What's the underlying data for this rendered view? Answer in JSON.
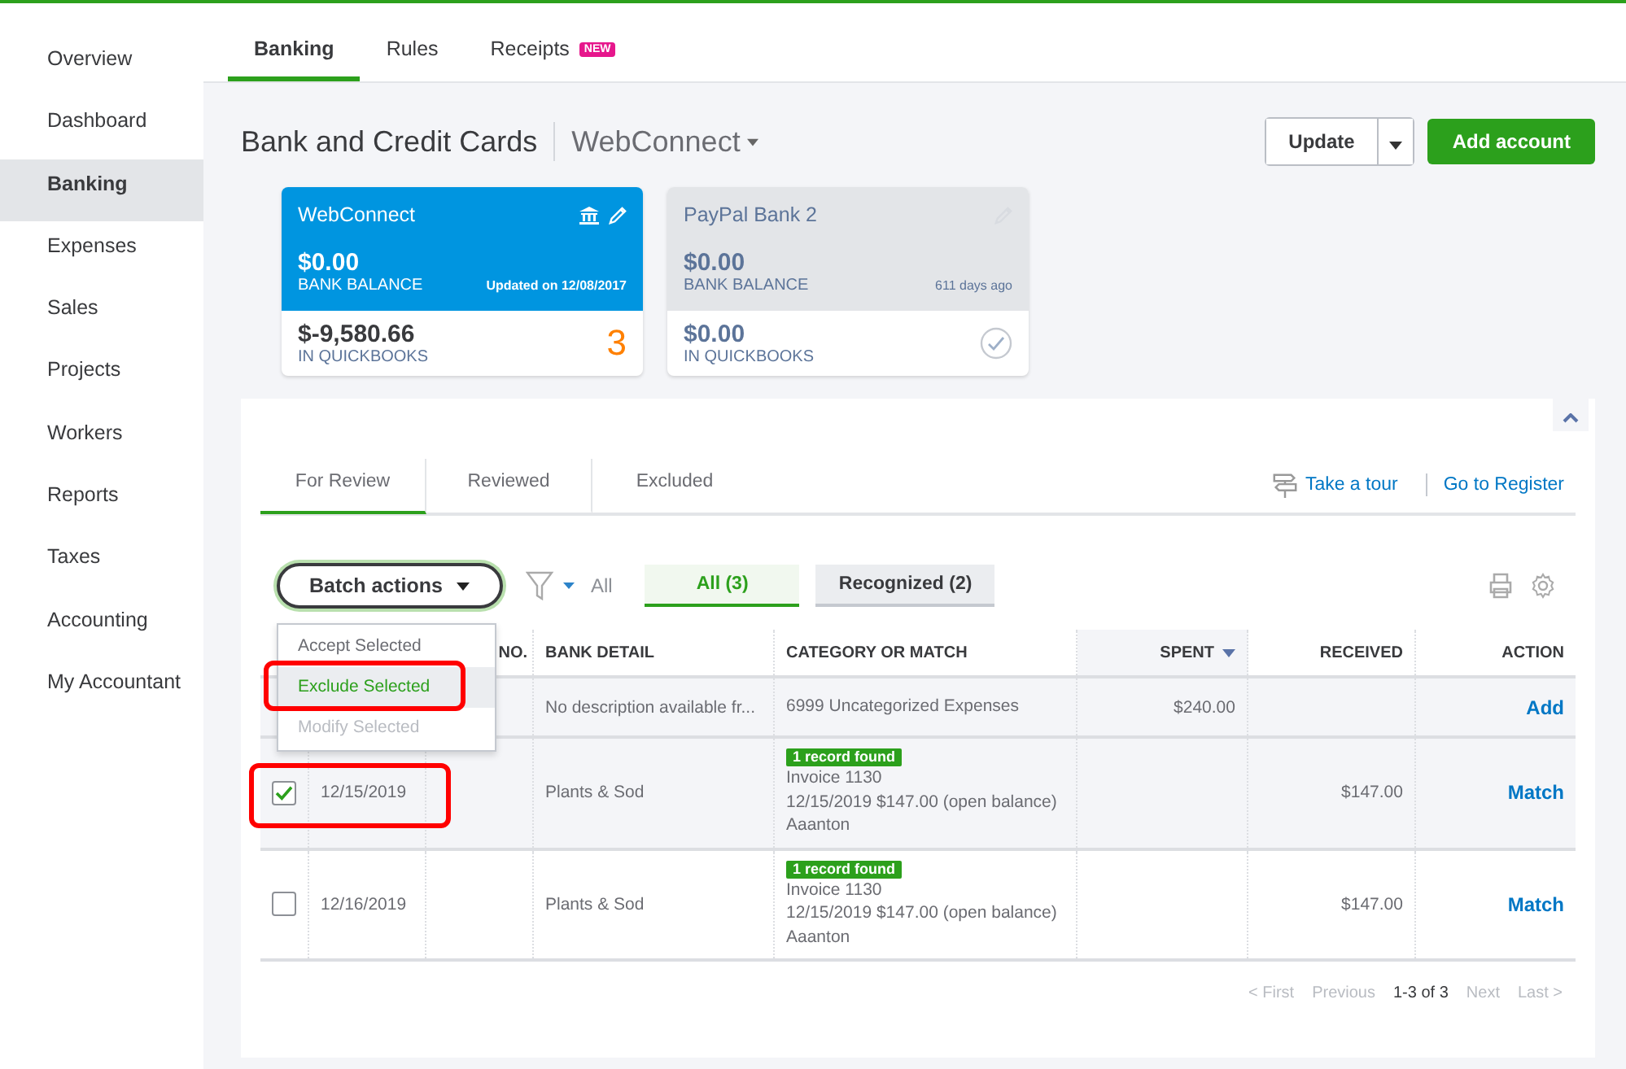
{
  "sidebar": {
    "items": [
      {
        "label": "Overview",
        "selected": false
      },
      {
        "label": "Dashboard",
        "selected": false
      },
      {
        "label": "Banking",
        "selected": true
      },
      {
        "label": "Expenses",
        "selected": false
      },
      {
        "label": "Sales",
        "selected": false
      },
      {
        "label": "Projects",
        "selected": false
      },
      {
        "label": "Workers",
        "selected": false
      },
      {
        "label": "Reports",
        "selected": false
      },
      {
        "label": "Taxes",
        "selected": false
      },
      {
        "label": "Accounting",
        "selected": false
      },
      {
        "label": "My Accountant",
        "selected": false
      }
    ]
  },
  "top_tabs": [
    {
      "label": "Banking",
      "selected": true
    },
    {
      "label": "Rules",
      "selected": false
    },
    {
      "label": "Receipts",
      "selected": false,
      "badge": "NEW"
    }
  ],
  "header": {
    "title": "Bank and Credit Cards",
    "account": "WebConnect",
    "buttons": [
      {
        "label": "Update",
        "kind": "split"
      },
      {
        "label": "Add account",
        "kind": "primary"
      }
    ]
  },
  "cards": [
    {
      "name": "WebConnect",
      "selected": true,
      "bank_balance": "$0.00",
      "bank_label": "BANK BALANCE",
      "updated": "Updated on 12/08/2017",
      "qb_balance": "$-9,580.66",
      "qb_label": "IN QUICKBOOKS",
      "count": "3"
    },
    {
      "name": "PayPal Bank 2",
      "selected": false,
      "bank_balance": "$0.00",
      "bank_label": "BANK BALANCE",
      "updated": "611 days ago",
      "qb_balance": "$0.00",
      "qb_label": "IN QUICKBOOKS"
    }
  ],
  "review_tabs": [
    {
      "label": "For Review",
      "selected": true
    },
    {
      "label": "Reviewed",
      "selected": false
    },
    {
      "label": "Excluded",
      "selected": false
    }
  ],
  "links": [
    "Take a tour",
    "Go to Register"
  ],
  "toolbar": {
    "batch_button": "Batch actions",
    "filter_label": "All",
    "chips": [
      {
        "label": "All (3)",
        "selected": true
      },
      {
        "label": "Recognized (2)",
        "selected": false
      }
    ]
  },
  "batch_menu": [
    {
      "label": "Accept Selected",
      "selected": false,
      "disabled": false,
      "highlighted": false
    },
    {
      "label": "Exclude Selected",
      "selected": true,
      "disabled": false,
      "highlighted": true
    },
    {
      "label": "Modify Selected",
      "selected": false,
      "disabled": true,
      "highlighted": false
    }
  ],
  "table": {
    "columns": [
      {
        "label": "NO.",
        "sorted": false
      },
      {
        "label": "BANK DETAIL",
        "sorted": false
      },
      {
        "label": "CATEGORY OR MATCH",
        "sorted": false
      },
      {
        "label": "SPENT",
        "sorted": true
      },
      {
        "label": "RECEIVED",
        "sorted": false
      },
      {
        "label": "ACTION",
        "sorted": false
      }
    ],
    "rows": [
      {
        "bank_detail": "No description available fr...",
        "category": "6999 Uncategorized Expenses",
        "spent": "$240.00",
        "action": "Add",
        "highlighted": false
      },
      {
        "checked": true,
        "date": "12/15/2019",
        "bank_detail": "Plants & Sod",
        "badge": "1 record found",
        "match_lines": [
          "Invoice 1130",
          "12/15/2019 $147.00 (open balance)",
          "Aaanton"
        ],
        "received": "$147.00",
        "action": "Match",
        "highlighted": true
      },
      {
        "checked": false,
        "date": "12/16/2019",
        "bank_detail": "Plants & Sod",
        "badge": "1 record found",
        "match_lines": [
          "Invoice 1130",
          "12/15/2019 $147.00 (open balance)",
          "Aaanton"
        ],
        "received": "$147.00",
        "action": "Match",
        "highlighted": false
      }
    ]
  },
  "pager": [
    {
      "label": "< First",
      "disabled": true
    },
    {
      "label": "Previous",
      "disabled": true
    },
    {
      "label": "1-3 of 3",
      "disabled": false
    },
    {
      "label": "Next",
      "disabled": true
    },
    {
      "label": "Last >",
      "disabled": true
    }
  ]
}
